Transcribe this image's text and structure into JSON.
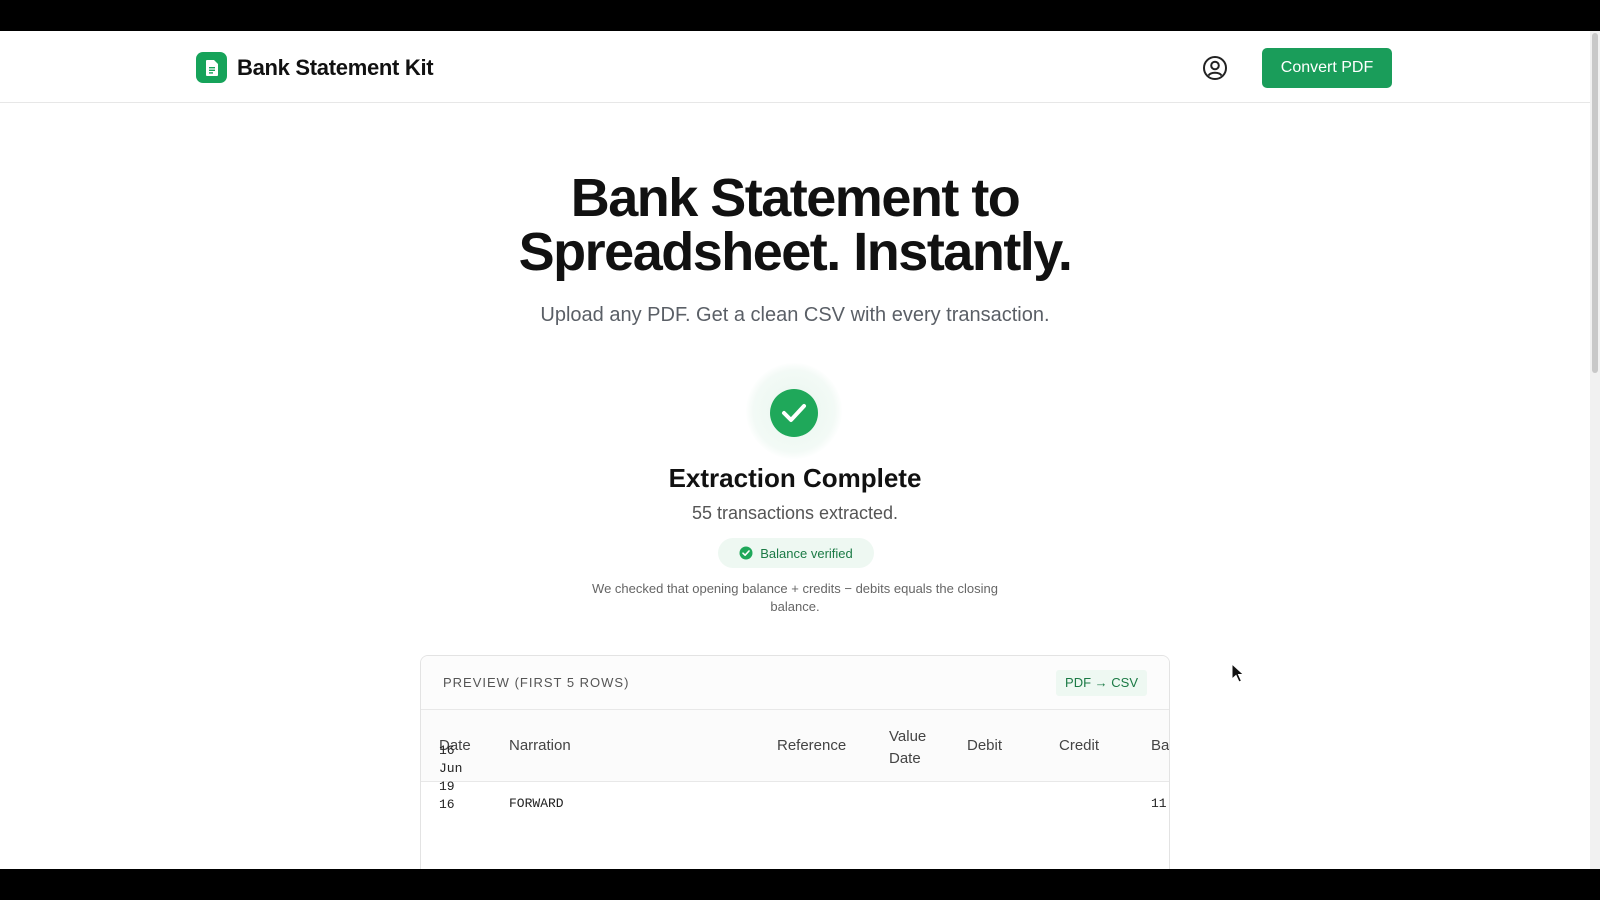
{
  "header": {
    "brand_name": "Bank Statement Kit",
    "convert_label": "Convert PDF"
  },
  "hero": {
    "title_line1": "Bank Statement to",
    "title_line2": "Spreadsheet. Instantly.",
    "subtitle": "Upload any PDF. Get a clean CSV with every transaction."
  },
  "result": {
    "title": "Extraction Complete",
    "count_text": "55 transactions extracted.",
    "badge_label": "Balance verified",
    "note": "We checked that opening balance + credits − debits equals the closing balance."
  },
  "preview": {
    "label": "PREVIEW (FIRST 5 ROWS)",
    "tag": "PDF → CSV",
    "columns": [
      "Date",
      "Narration",
      "Reference",
      "Value Date",
      "Debit",
      "Credit",
      "Ba"
    ],
    "rows": [
      {
        "date_lines": [
          "16",
          "Jun",
          "19",
          "16"
        ],
        "narration": "FORWARD",
        "balance": "11"
      }
    ]
  },
  "colors": {
    "brand_green": "#16a35a",
    "button_green": "#1a9d5a",
    "badge_bg": "#eef8f2",
    "badge_text": "#1b7a45"
  },
  "icons": {
    "brand": "document-icon",
    "user": "user-circle-icon",
    "success": "check-circle-icon",
    "badge": "verified-badge-icon"
  }
}
